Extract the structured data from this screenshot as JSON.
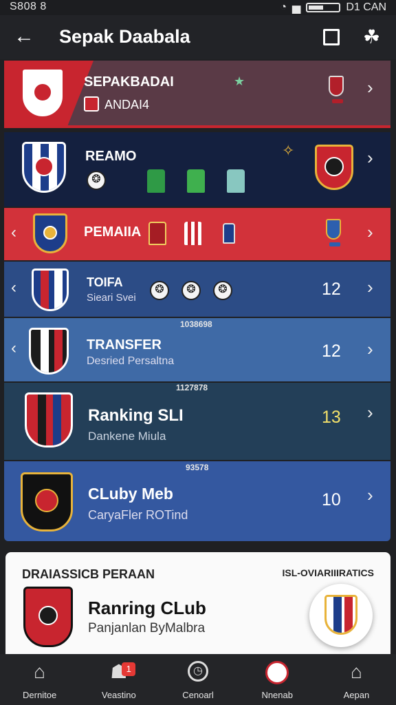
{
  "status": {
    "left": "S808 8",
    "right": "D1 CAN",
    "battery_level": 0.45
  },
  "appbar": {
    "title": "Sepak Daabala",
    "back_icon": "arrow-left-icon",
    "bookmark_icon": "bookmark-icon",
    "share_icon": "share-icon"
  },
  "rows": [
    {
      "title": "SEPAKBADAI",
      "subtitle": "ANDAI4",
      "bg": "#5a3a46"
    },
    {
      "title": "REAMO",
      "bg": "#14203f"
    },
    {
      "title": "PEMAIIA",
      "bg": "#d2323a"
    },
    {
      "title": "TOIFA",
      "subtitle": "Sieari Svei",
      "number": "12",
      "bg": "#2c4c86"
    },
    {
      "title": "TRANSFER",
      "subtitle": "Desried Persaltna",
      "number": "12",
      "tag": "1038698",
      "bg": "#3f6aa6"
    },
    {
      "title": "Ranking SLI",
      "subtitle": "Dankene Miula",
      "number": "13",
      "tag": "1127878",
      "bg": "#233f58"
    },
    {
      "title": "CLuby Meb",
      "subtitle": "CaryaFler ROTind",
      "number": "10",
      "tag": "93578",
      "bg": "#3458a0"
    }
  ],
  "card": {
    "heading_left": "DRAIASSICB PERAAN",
    "heading_right": "ISL-OVIARIIIRATICS",
    "title": "Ranring CLub",
    "subtitle": "Panjanlan ByMalbra"
  },
  "nav": [
    {
      "label": "Dernitoe",
      "icon": "home-icon"
    },
    {
      "label": "Veastino",
      "icon": "building-icon",
      "badge": "1"
    },
    {
      "label": "Cenoarl",
      "icon": "search-icon"
    },
    {
      "label": "Nnenab",
      "icon": "ball-icon"
    },
    {
      "label": "Aepan",
      "icon": "house-icon"
    }
  ]
}
